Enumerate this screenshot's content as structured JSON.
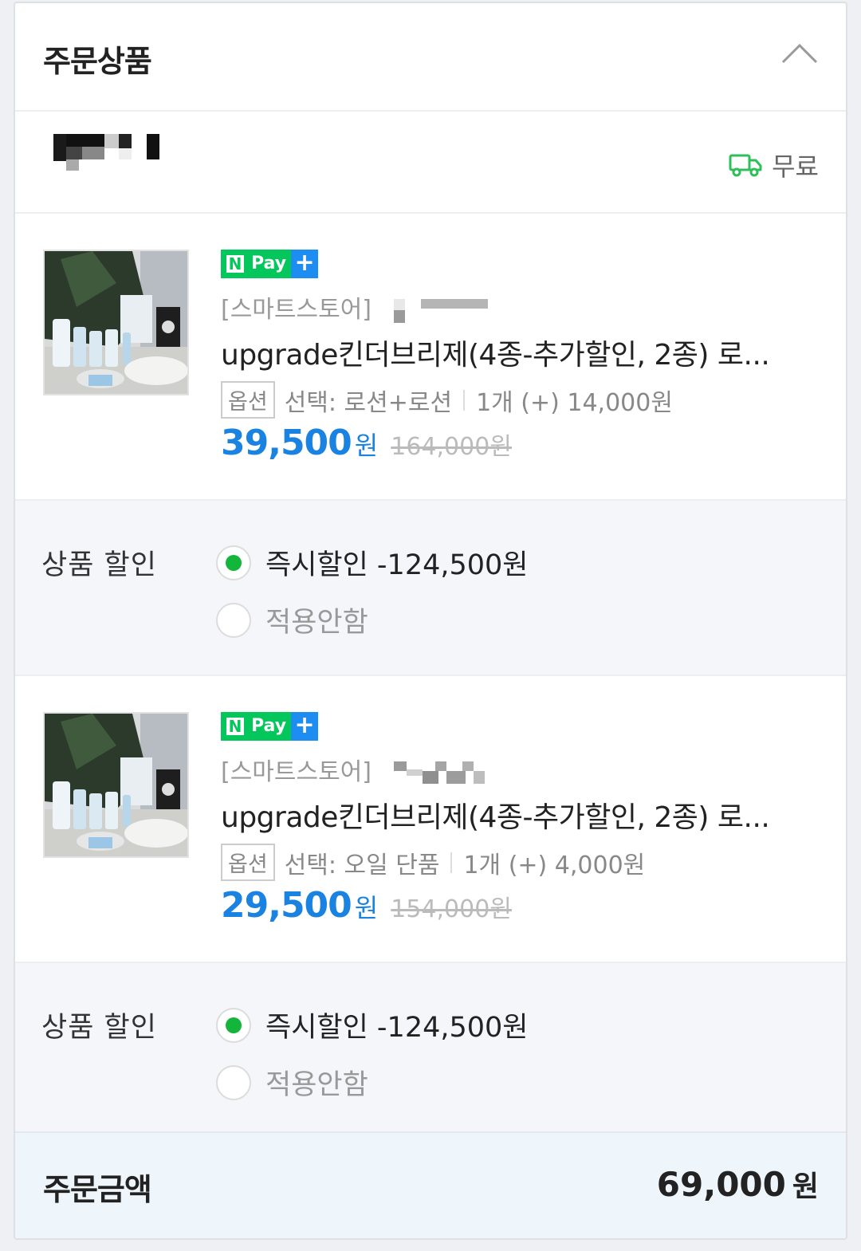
{
  "header": {
    "title": "주문상품"
  },
  "seller": {
    "shipping_label": "무료"
  },
  "items": [
    {
      "npay_pay": "Pay",
      "npay_plus": "+",
      "store": "[스마트스토어]",
      "title": "upgrade킨더브리제(4종-추가할인, 2종) 로...",
      "option_tag": "옵션",
      "option_text": "선택: 로션+로션",
      "qty_text": "1개 (+) 14,000원",
      "price": "39,500",
      "price_unit": "원",
      "original_price": "164,000원"
    },
    {
      "npay_pay": "Pay",
      "npay_plus": "+",
      "store": "[스마트스토어]",
      "title": "upgrade킨더브리제(4종-추가할인, 2종) 로...",
      "option_tag": "옵션",
      "option_text": "선택: 오일 단품",
      "qty_text": "1개 (+) 4,000원",
      "price": "29,500",
      "price_unit": "원",
      "original_price": "154,000원"
    }
  ],
  "discounts": [
    {
      "label": "상품 할인",
      "option_applied": "즉시할인 -124,500원",
      "option_none": "적용안함"
    },
    {
      "label": "상품 할인",
      "option_applied": "즉시할인 -124,500원",
      "option_none": "적용안함"
    }
  ],
  "total": {
    "label": "주문금액",
    "value": "69,000",
    "unit": "원"
  },
  "colors": {
    "price_blue": "#1a82e0",
    "npay_green": "#03c75a",
    "radio_green": "#13b53a",
    "plus_blue": "#1d8df2"
  }
}
